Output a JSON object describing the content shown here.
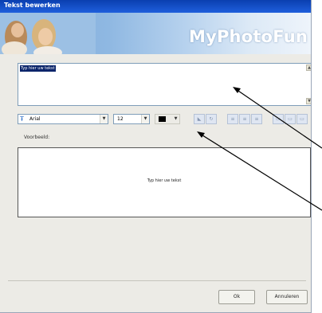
{
  "window": {
    "title": "Tekst bewerken",
    "brand": "MyPhotoFun"
  },
  "editor": {
    "selected_text": "Typ hier uw tekst"
  },
  "toolbar": {
    "font_value": "Arial",
    "size_value": "12",
    "color": "#000000",
    "font_icon": "font-icon"
  },
  "preview": {
    "label": "Voorbeeld:",
    "text": "Typ hier uw tekst"
  },
  "buttons": {
    "ok": "Ok",
    "cancel": "Annuleren"
  }
}
